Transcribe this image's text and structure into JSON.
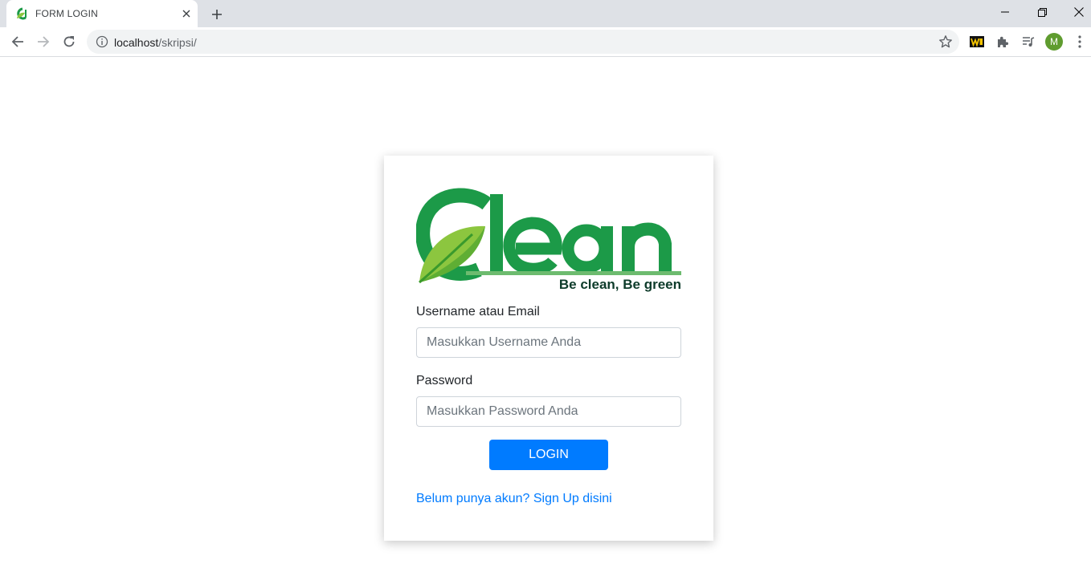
{
  "browser": {
    "tab_title": "FORM LOGIN",
    "url_host": "localhost",
    "url_path": "/skripsi/",
    "profile_initial": "M"
  },
  "icons": {
    "back": "arrow-left-icon",
    "forward": "arrow-right-icon",
    "reload": "reload-icon",
    "info": "info-icon",
    "star": "star-icon",
    "extensions": "puzzle-icon",
    "media": "playlist-icon",
    "menu": "kebab-menu-icon"
  },
  "logo": {
    "word": "Clean",
    "tagline": "Be clean, Be green",
    "colors": {
      "green": "#1c9a48",
      "leaf_light": "#8cc63f",
      "leaf_dark": "#3a9a2c",
      "tagline": "#0d3b2a",
      "underline": "#6dbb6f"
    }
  },
  "form": {
    "username_label": "Username atau Email",
    "username_placeholder": "Masukkan Username Anda",
    "password_label": "Password",
    "password_placeholder": "Masukkan Password Anda",
    "login_label": "LOGIN",
    "signup_link": "Belum punya akun? Sign Up disini"
  },
  "colors": {
    "primary": "#007bff",
    "chrome_bg": "#dee1e6"
  }
}
